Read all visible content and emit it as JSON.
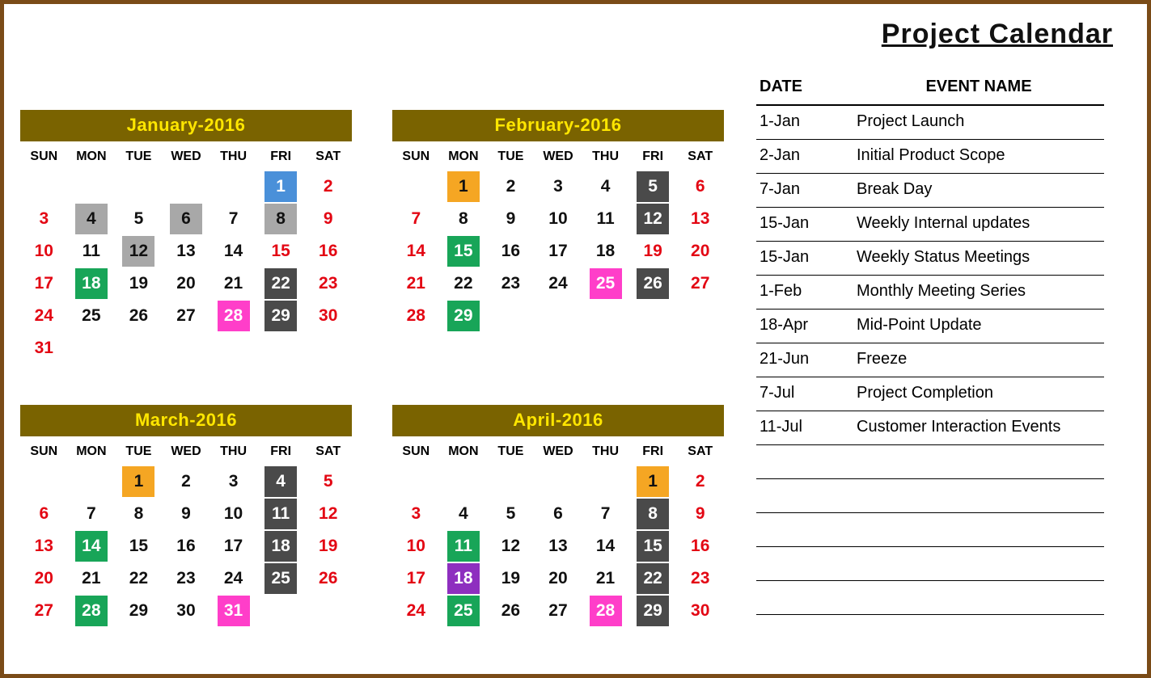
{
  "title": "Project Calendar",
  "dow": [
    "SUN",
    "MON",
    "TUE",
    "WED",
    "THU",
    "FRI",
    "SAT"
  ],
  "months": [
    {
      "name": "January-2016",
      "weeks": [
        [
          null,
          null,
          null,
          null,
          null,
          {
            "n": 1,
            "c": "blue"
          },
          {
            "n": 2,
            "w": true
          }
        ],
        [
          {
            "n": 3,
            "w": true
          },
          {
            "n": 4,
            "c": "lightgray"
          },
          {
            "n": 5
          },
          {
            "n": 6,
            "c": "lightgray"
          },
          {
            "n": 7
          },
          {
            "n": 8,
            "c": "lightgray"
          },
          {
            "n": 9,
            "w": true
          }
        ],
        [
          {
            "n": 10,
            "w": true
          },
          {
            "n": 11
          },
          {
            "n": 12,
            "c": "lightgray"
          },
          {
            "n": 13
          },
          {
            "n": 14
          },
          {
            "n": 15,
            "w": true
          },
          {
            "n": 16,
            "w": true
          }
        ],
        [
          {
            "n": 17,
            "w": true
          },
          {
            "n": 18,
            "c": "green"
          },
          {
            "n": 19
          },
          {
            "n": 20
          },
          {
            "n": 21
          },
          {
            "n": 22,
            "c": "darkgray"
          },
          {
            "n": 23,
            "w": true
          }
        ],
        [
          {
            "n": 24,
            "w": true
          },
          {
            "n": 25
          },
          {
            "n": 26
          },
          {
            "n": 27
          },
          {
            "n": 28,
            "c": "pink"
          },
          {
            "n": 29,
            "c": "darkgray"
          },
          {
            "n": 30,
            "w": true
          }
        ],
        [
          {
            "n": 31,
            "w": true
          },
          null,
          null,
          null,
          null,
          null,
          null
        ]
      ]
    },
    {
      "name": "February-2016",
      "weeks": [
        [
          null,
          {
            "n": 1,
            "c": "orange"
          },
          {
            "n": 2
          },
          {
            "n": 3
          },
          {
            "n": 4
          },
          {
            "n": 5,
            "c": "darkgray"
          },
          {
            "n": 6,
            "w": true
          }
        ],
        [
          {
            "n": 7,
            "w": true
          },
          {
            "n": 8
          },
          {
            "n": 9
          },
          {
            "n": 10
          },
          {
            "n": 11
          },
          {
            "n": 12,
            "c": "darkgray"
          },
          {
            "n": 13,
            "w": true
          }
        ],
        [
          {
            "n": 14,
            "w": true
          },
          {
            "n": 15,
            "c": "green"
          },
          {
            "n": 16
          },
          {
            "n": 17
          },
          {
            "n": 18
          },
          {
            "n": 19,
            "w": true
          },
          {
            "n": 20,
            "w": true
          }
        ],
        [
          {
            "n": 21,
            "w": true
          },
          {
            "n": 22
          },
          {
            "n": 23
          },
          {
            "n": 24
          },
          {
            "n": 25,
            "c": "pink"
          },
          {
            "n": 26,
            "c": "darkgray"
          },
          {
            "n": 27,
            "w": true
          }
        ],
        [
          {
            "n": 28,
            "w": true
          },
          {
            "n": 29,
            "c": "green"
          },
          null,
          null,
          null,
          null,
          null
        ]
      ]
    },
    {
      "name": "March-2016",
      "weeks": [
        [
          null,
          null,
          {
            "n": 1,
            "c": "orange"
          },
          {
            "n": 2
          },
          {
            "n": 3
          },
          {
            "n": 4,
            "c": "darkgray"
          },
          {
            "n": 5,
            "w": true
          }
        ],
        [
          {
            "n": 6,
            "w": true
          },
          {
            "n": 7
          },
          {
            "n": 8
          },
          {
            "n": 9
          },
          {
            "n": 10
          },
          {
            "n": 11,
            "c": "darkgray"
          },
          {
            "n": 12,
            "w": true
          }
        ],
        [
          {
            "n": 13,
            "w": true
          },
          {
            "n": 14,
            "c": "green"
          },
          {
            "n": 15
          },
          {
            "n": 16
          },
          {
            "n": 17
          },
          {
            "n": 18,
            "c": "darkgray"
          },
          {
            "n": 19,
            "w": true
          }
        ],
        [
          {
            "n": 20,
            "w": true
          },
          {
            "n": 21
          },
          {
            "n": 22
          },
          {
            "n": 23
          },
          {
            "n": 24
          },
          {
            "n": 25,
            "c": "darkgray"
          },
          {
            "n": 26,
            "w": true
          }
        ],
        [
          {
            "n": 27,
            "w": true
          },
          {
            "n": 28,
            "c": "green"
          },
          {
            "n": 29
          },
          {
            "n": 30
          },
          {
            "n": 31,
            "c": "pink"
          },
          null,
          null
        ]
      ]
    },
    {
      "name": "April-2016",
      "weeks": [
        [
          null,
          null,
          null,
          null,
          null,
          {
            "n": 1,
            "c": "orange"
          },
          {
            "n": 2,
            "w": true
          }
        ],
        [
          {
            "n": 3,
            "w": true
          },
          {
            "n": 4
          },
          {
            "n": 5
          },
          {
            "n": 6
          },
          {
            "n": 7
          },
          {
            "n": 8,
            "c": "darkgray"
          },
          {
            "n": 9,
            "w": true
          }
        ],
        [
          {
            "n": 10,
            "w": true
          },
          {
            "n": 11,
            "c": "green"
          },
          {
            "n": 12
          },
          {
            "n": 13
          },
          {
            "n": 14
          },
          {
            "n": 15,
            "c": "darkgray"
          },
          {
            "n": 16,
            "w": true
          }
        ],
        [
          {
            "n": 17,
            "w": true
          },
          {
            "n": 18,
            "c": "purple"
          },
          {
            "n": 19
          },
          {
            "n": 20
          },
          {
            "n": 21
          },
          {
            "n": 22,
            "c": "darkgray"
          },
          {
            "n": 23,
            "w": true
          }
        ],
        [
          {
            "n": 24,
            "w": true
          },
          {
            "n": 25,
            "c": "green"
          },
          {
            "n": 26
          },
          {
            "n": 27
          },
          {
            "n": 28,
            "c": "pink"
          },
          {
            "n": 29,
            "c": "darkgray"
          },
          {
            "n": 30,
            "w": true
          }
        ]
      ]
    }
  ],
  "events_header": {
    "date": "DATE",
    "name": "EVENT NAME"
  },
  "events": [
    {
      "date": "1-Jan",
      "name": "Project Launch"
    },
    {
      "date": "2-Jan",
      "name": "Initial Product Scope"
    },
    {
      "date": "7-Jan",
      "name": "Break Day"
    },
    {
      "date": "15-Jan",
      "name": "Weekly Internal updates"
    },
    {
      "date": "15-Jan",
      "name": "Weekly Status Meetings"
    },
    {
      "date": "1-Feb",
      "name": "Monthly Meeting Series"
    },
    {
      "date": "18-Apr",
      "name": "Mid-Point Update"
    },
    {
      "date": "21-Jun",
      "name": "Freeze"
    },
    {
      "date": "7-Jul",
      "name": "Project Completion"
    },
    {
      "date": "11-Jul",
      "name": "Customer Interaction Events"
    },
    {
      "date": "",
      "name": ""
    },
    {
      "date": "",
      "name": ""
    },
    {
      "date": "",
      "name": ""
    },
    {
      "date": "",
      "name": ""
    },
    {
      "date": "",
      "name": ""
    }
  ]
}
